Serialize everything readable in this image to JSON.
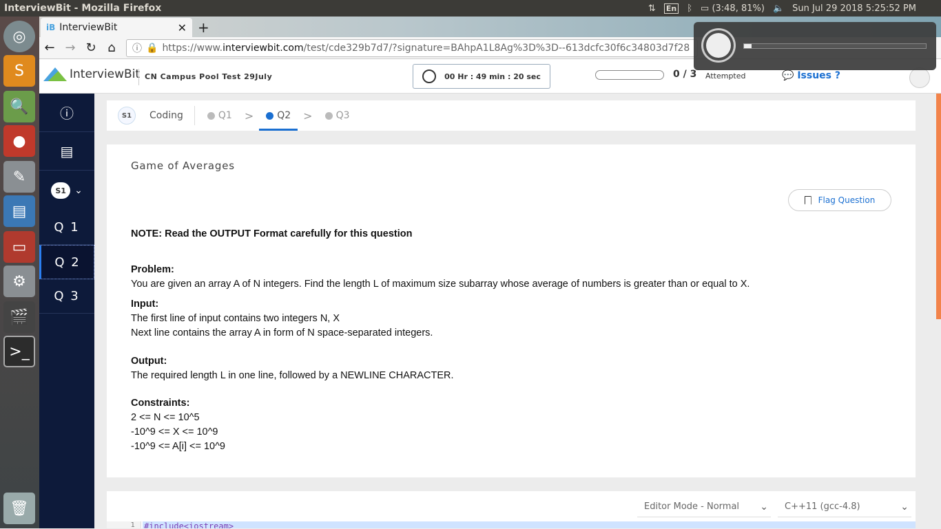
{
  "os": {
    "window_title": "InterviewBit - Mozilla Firefox",
    "lang": "En",
    "battery": "(3:48, 81%)",
    "datetime": "Sun Jul 29 2018  5:25:52 PM"
  },
  "browser": {
    "tab_title": "InterviewBit",
    "tab_favicon": "iB",
    "url_prefix": "https://www.",
    "url_domain": "interviewbit.com",
    "url_path": "/test/cde329b7d7/?signature=BAhpA1L8Ag%3D%3D--613dcfc30f6c34803d7f28"
  },
  "brightness_osd": {
    "level": 0.04
  },
  "header": {
    "logo": "InterviewBit",
    "test_name": "CN Campus Pool Test 29July",
    "timer": "00 Hr : 49 min : 20 sec",
    "attempted_count": "0 / 3",
    "attempted_label": "Attempted",
    "issues": "Issues ?",
    "progress": 0
  },
  "sidenav": {
    "section": "S1",
    "questions": [
      "Q 1",
      "Q 2",
      "Q 3"
    ],
    "active": 1
  },
  "breadcrumb": {
    "section": "S1",
    "label": "Coding",
    "items": [
      "Q1",
      "Q2",
      "Q3"
    ],
    "current": "Q2"
  },
  "problem": {
    "title": "Game of Averages",
    "flag": "Flag Question",
    "note": "NOTE: Read the OUTPUT Format carefully for this question",
    "problem_label": "Problem:",
    "problem_text": "You are given an array A of N integers. Find the length L of maximum size subarray whose average of numbers is greater than or equal to X.",
    "input_label": "Input:",
    "input_line1": "The first line of input contains two integers N, X",
    "input_line2": "Next line contains the array A in form of N space-separated integers.",
    "output_label": "Output:",
    "output_text": "The required length L in one line, followed by a NEWLINE CHARACTER.",
    "constraints_label": "Constraints:",
    "constraints": [
      "2 <= N <= 10^5",
      "-10^9 <= X <= 10^9",
      "-10^9 <= A[i] <= 10^9"
    ]
  },
  "editor": {
    "mode": "Editor Mode - Normal",
    "language": "C++11 (gcc-4.8)",
    "line_number": "1",
    "first_line": "#include<iostream>"
  }
}
